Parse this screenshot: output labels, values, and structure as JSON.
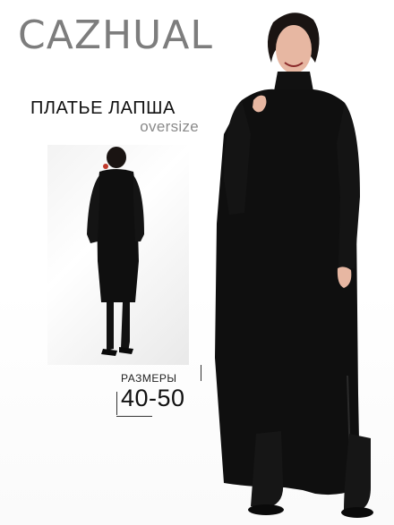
{
  "brand": {
    "name": "CAZHUAL"
  },
  "product": {
    "title": "ПЛАТЬЕ ЛАПША",
    "subtitle": "oversize",
    "sizes_label": "РАЗМЕРЫ",
    "sizes_value": "40-50"
  },
  "colors": {
    "brand_gray": "#7d7d7d",
    "dress": "#0f0f0f",
    "skin": "#e7b7a2",
    "background": "#ffffff"
  }
}
